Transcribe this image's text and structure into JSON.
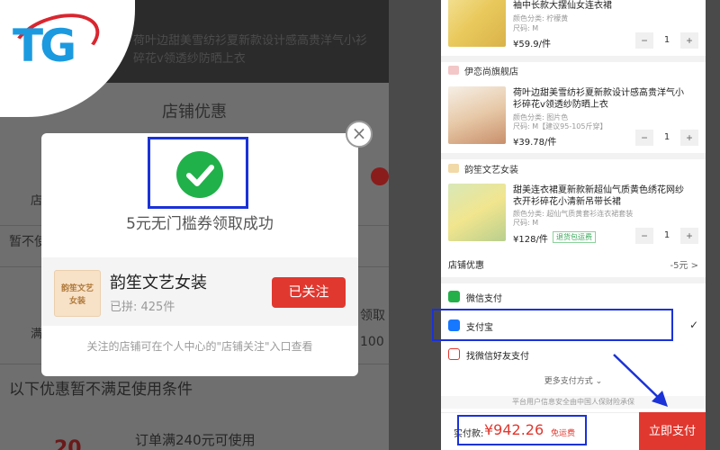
{
  "logo": {
    "text": "TG"
  },
  "background": {
    "top_text_1": "荷叶边甜美雪纺衫夏新款设计感高贵洋气小衫",
    "top_text_2": "碎花v领透纱防晒上衣",
    "sheet_title": "店铺优惠",
    "item_1": "店",
    "item_2": "暂不使",
    "item_3": "满",
    "item_3b": "领取",
    "item_3c": "100",
    "unmet": "以下优惠暂不满足使用条件",
    "condition": "订单满240元可使用",
    "big_num": "20"
  },
  "modal": {
    "close_symbol": "×",
    "success_text": "5元无门槛券领取成功",
    "shop_logo_line1": "韵笙文艺",
    "shop_logo_line2": "女装",
    "shop_name": "韵笙文艺女装",
    "shop_sold": "已拼: 425件",
    "follow_label": "已关注",
    "note": "关注的店铺可在个人中心的\"店铺关注\"入口查看"
  },
  "cart": {
    "products": [
      {
        "title": "袖中长款大摆仙女连衣裙",
        "attr1": "颜色分类: 柠檬黄",
        "attr2": "尺码: M",
        "price": "¥59.9/件",
        "qty": "1"
      },
      {
        "title": "荷叶边甜美雪纺衫夏新款设计感高贵洋气小衫碎花v领透纱防晒上衣",
        "attr1": "颜色分类: 图片色",
        "attr2": "尺码: M【建议95-105斤穿】",
        "price": "¥39.78/件",
        "qty": "1"
      },
      {
        "title": "甜美连衣裙夏新款新超仙气质黄色绣花网纱衣开衫碎花小清新吊带长裙",
        "attr1": "颜色分类: 超仙气质黄套衫连衣裙套装",
        "attr2": "尺码: M",
        "price": "¥128/件",
        "qty": "1",
        "tag": "退货包运费"
      }
    ],
    "shops": [
      "伊恋尚旗舰店",
      "韵笙文艺女装"
    ],
    "coupon_label": "店铺优惠",
    "coupon_value": "-5元 >",
    "minus": "−",
    "plus": "+"
  },
  "payment": {
    "wechat": "微信支付",
    "alipay": "支付宝",
    "friend": "找微信好友支付",
    "more": "更多支付方式 ⌄",
    "secure": "平台用户信息安全由中国人保财险承保",
    "check": "✓",
    "total_label": "实付款:",
    "total_value": "¥942.26",
    "free_ship": "免运费",
    "pay_button": "立即支付"
  },
  "colors": {
    "accent_red": "#e0382f",
    "highlight_blue": "#1a32d8",
    "success_green": "#21b14a"
  }
}
